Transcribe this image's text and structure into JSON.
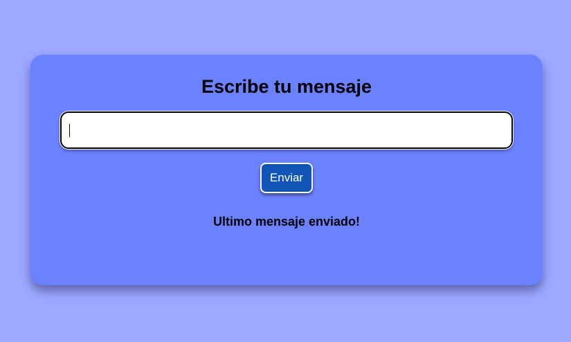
{
  "form": {
    "title": "Escribe tu mensaje",
    "input_value": "",
    "input_placeholder": "",
    "send_label": "Enviar",
    "status_text": "Ultimo mensaje enviado!"
  },
  "colors": {
    "background": "#9ea8ff",
    "card": "#6b82ff",
    "button": "#0f55b8"
  }
}
